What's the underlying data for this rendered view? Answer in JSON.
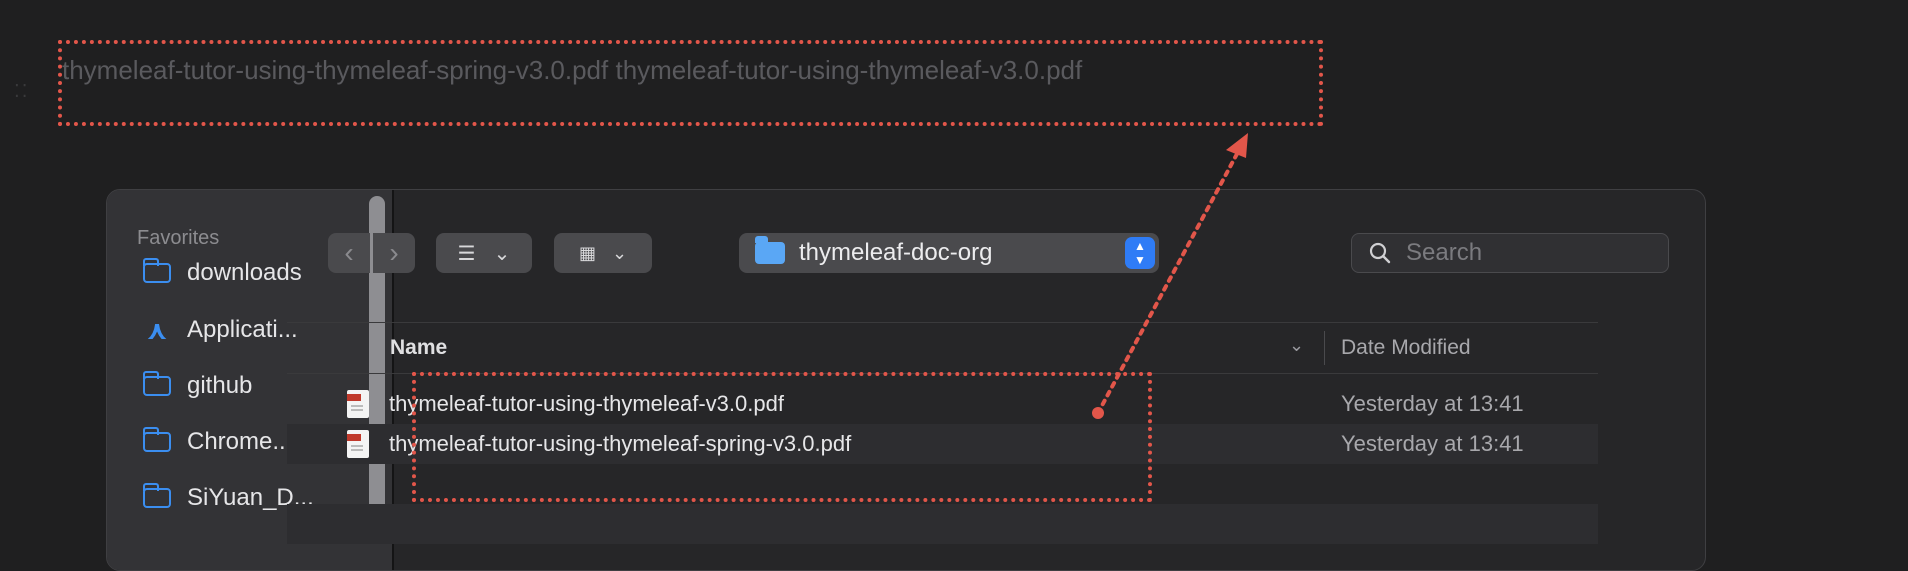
{
  "drop_target": {
    "text": "thymeleaf-tutor-using-thymeleaf-spring-v3.0.pdf thymeleaf-tutor-using-thymeleaf-v3.0.pdf"
  },
  "finder": {
    "sidebar": {
      "heading": "Favorites",
      "items": [
        {
          "label": "downloads",
          "icon": "folder-icon"
        },
        {
          "label": "Applicati...",
          "icon": "applications-icon"
        },
        {
          "label": "github",
          "icon": "folder-icon"
        },
        {
          "label": "Chrome...",
          "icon": "folder-icon"
        },
        {
          "label": "SiYuan_D...",
          "icon": "folder-icon"
        }
      ]
    },
    "toolbar": {
      "back": "‹",
      "forward": "›",
      "list_view_glyph": "☰",
      "grid_view_glyph": "▦",
      "chevron": "⌄",
      "path": "thymeleaf-doc-org",
      "search_placeholder": "Search"
    },
    "columns": {
      "name": "Name",
      "sort_glyph": "⌄",
      "date_modified": "Date Modified"
    },
    "files": [
      {
        "name": "thymeleaf-tutor-using-thymeleaf-v3.0.pdf",
        "date": "Yesterday at 13:41"
      },
      {
        "name": "thymeleaf-tutor-using-thymeleaf-spring-v3.0.pdf",
        "date": "Yesterday at 13:41"
      }
    ]
  },
  "colors": {
    "background": "#1f1f20",
    "accent": "#3b8ef0",
    "annotation": "#e2564a"
  }
}
